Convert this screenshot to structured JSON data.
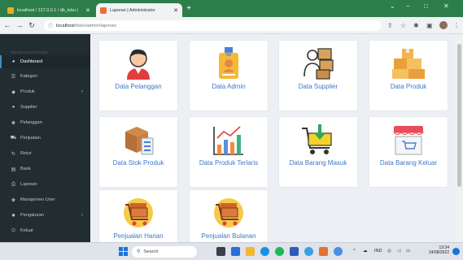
{
  "tabs": [
    {
      "label": "localhost / 127.0.0.1 / db_toko | ",
      "close": "✕"
    },
    {
      "label": "Laporan | Administrator",
      "close": "✕"
    }
  ],
  "new_tab": "+",
  "window_controls": {
    "minimize": "⌄",
    "restore": "–",
    "maximize": "□",
    "close": "✕"
  },
  "address": {
    "host": "localhost",
    "path": "/toko/admin/laporan"
  },
  "sidebar": {
    "header": "MAIN NAVIGATION",
    "items": [
      {
        "label": "Dashboard",
        "icon": "dashboard-icon"
      },
      {
        "label": "Kategori",
        "icon": "list-icon"
      },
      {
        "label": "Produk",
        "icon": "cubes-icon",
        "caret": "‹"
      },
      {
        "label": "Supplier",
        "icon": "user-icon"
      },
      {
        "label": "Pelanggan",
        "icon": "users-icon"
      },
      {
        "label": "Penjualan",
        "icon": "shopping-icon"
      },
      {
        "label": "Retur",
        "icon": "refresh-icon"
      },
      {
        "label": "Bank",
        "icon": "bank-icon"
      },
      {
        "label": "Laporan",
        "icon": "print-icon"
      },
      {
        "label": "Manajemen User",
        "icon": "users-cog-icon"
      },
      {
        "label": "Pengaturan",
        "icon": "gear-icon",
        "caret": "‹"
      },
      {
        "label": "Keluar",
        "icon": "power-icon"
      }
    ]
  },
  "cards": [
    {
      "label": "Data Pelanggan",
      "icon": "customer-icon"
    },
    {
      "label": "Data Admin",
      "icon": "admin-badge-icon"
    },
    {
      "label": "Data Supplier",
      "icon": "supplier-icon"
    },
    {
      "label": "Data Produk",
      "icon": "boxes-icon"
    },
    {
      "label": "Data Stok Produk",
      "icon": "stock-icon"
    },
    {
      "label": "Data Produk Terlaris",
      "icon": "growth-chart-icon"
    },
    {
      "label": "Data Barang Masuk",
      "icon": "cart-in-icon"
    },
    {
      "label": "Data Barang Keluar",
      "icon": "store-icon"
    },
    {
      "label": "Penjualan Harian",
      "icon": "sales-cart-icon"
    },
    {
      "label": "Penjualan Bulanan",
      "icon": "sales-cart-icon"
    }
  ],
  "taskbar": {
    "search_placeholder": "Search",
    "lang": "IND",
    "time": "13:34",
    "date": "24/08/2022"
  }
}
